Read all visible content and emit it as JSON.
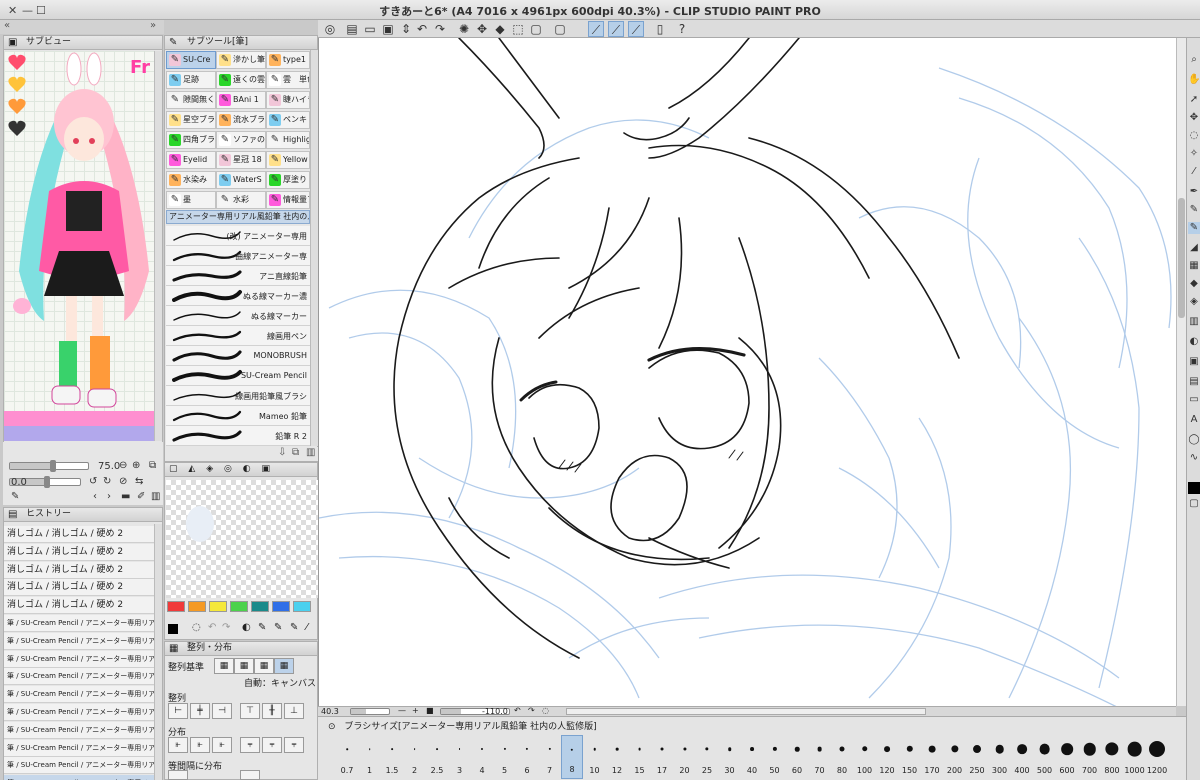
{
  "window": {
    "title": "すきあーと6* (A4 7016 x 4961px 600dpi 40.3%)  - CLIP STUDIO PAINT PRO"
  },
  "navigator": {
    "title": "サブビュー",
    "preview_label": "Fr",
    "zoom_value": "75.0",
    "rotate_value": "0.0"
  },
  "history": {
    "title": "ヒストリー",
    "items": [
      "消しゴム / 消しゴム / 硬め 2",
      "消しゴム / 消しゴム / 硬め 2",
      "消しゴム / 消しゴム / 硬め 2",
      "消しゴム / 消しゴム / 硬め 2",
      "消しゴム / 消しゴム / 硬め 2",
      "筆 / SU-Cream Pencil / アニメーター専用リアル風鉛筆",
      "筆 / SU-Cream Pencil / アニメーター専用リアル風鉛筆",
      "筆 / SU-Cream Pencil / アニメーター専用リアル風鉛筆",
      "筆 / SU-Cream Pencil / アニメーター専用リアル風鉛筆",
      "筆 / SU-Cream Pencil / アニメーター専用リアル風鉛筆",
      "筆 / SU-Cream Pencil / アニメーター専用リアル風鉛筆",
      "筆 / SU-Cream Pencil / アニメーター専用リアル風鉛筆",
      "筆 / SU-Cream Pencil / アニメーター専用リアル風鉛筆",
      "筆 / SU-Cream Pencil / アニメーター専用リアル風鉛筆",
      "筆 / SU-Cream Pencil / アニメーター専用リアル風鉛筆"
    ]
  },
  "subtool": {
    "title": "サブツール[筆]",
    "grid": [
      [
        "SU-Cre",
        "滲かし筆",
        "type1"
      ],
      [
        "足跡",
        "遠くの雲",
        "雲　単色"
      ],
      [
        "隙間無く",
        "BAni 1",
        "睫ハイラ"
      ],
      [
        "星空ブラ",
        "流水ブラ",
        "ペンキ C"
      ],
      [
        "四角ブラ",
        "ソファの",
        "Highlig"
      ],
      [
        "Eyelid",
        "星冠 18",
        "Yellow"
      ],
      [
        "水染み",
        "WaterS",
        "厚塗り"
      ],
      [
        "墨",
        "水彩",
        "情報量ブ"
      ]
    ],
    "group_tab": "アニメーター専用リアル風鉛筆 社内の人",
    "brushes": [
      "(改) アニメーター専用",
      "曲線アニメーター専",
      "アニ直線鉛筆",
      "ぬる線マーカー濃",
      "ぬる線マーカー",
      "線画用ペン",
      "MONOBRUSH",
      "SU-Cream Pencil",
      "線画用鉛筆風ブラシ",
      "Mameo 鉛筆",
      "鉛筆 R 2"
    ]
  },
  "color_panel": {
    "swatches": [
      "#f03a3a",
      "#f59a24",
      "#f5e83a",
      "#4cd24c",
      "#1a8a8a",
      "#2f6fe8",
      "#4ad0ee"
    ]
  },
  "align_panel": {
    "title": "整列・分布",
    "base_label": "整列基準",
    "auto_label": "自動：キャンバス",
    "align_label": "整列",
    "distribute_label": "分布",
    "equal_label": "等間隔に分布"
  },
  "status": {
    "zoom": "40.3",
    "angle": "-110.0"
  },
  "brush_size": {
    "title": "ブラシサイズ[アニメーター専用リアル風鉛筆 社内の人監修版]",
    "sizes": [
      "0.7",
      "1",
      "1.5",
      "2",
      "2.5",
      "3",
      "4",
      "5",
      "6",
      "7",
      "8",
      "10",
      "12",
      "15",
      "17",
      "20",
      "25",
      "30",
      "40",
      "50",
      "60",
      "70",
      "80",
      "100",
      "120",
      "150",
      "170",
      "200",
      "250",
      "300",
      "400",
      "500",
      "600",
      "700",
      "800",
      "1000",
      "1200"
    ],
    "selected": "8"
  },
  "accent_color": "#b6cfe8"
}
